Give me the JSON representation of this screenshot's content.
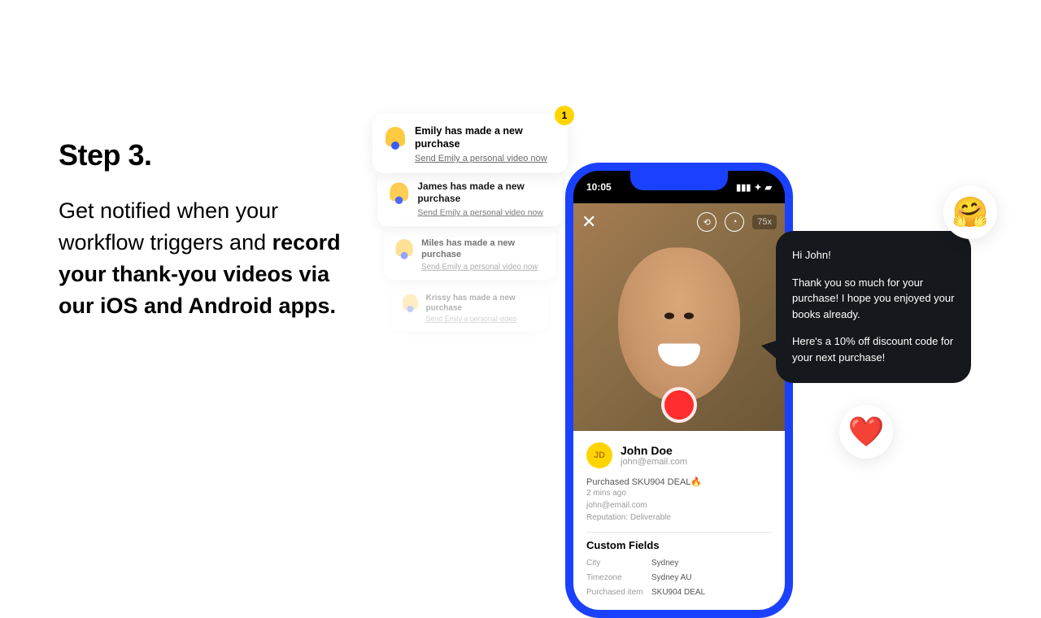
{
  "left": {
    "heading": "Step 3.",
    "body_plain": "Get notified when your workflow triggers and ",
    "body_bold": "record your thank-you videos via our iOS and Android apps."
  },
  "notifications": {
    "badge_count": "1",
    "cards": [
      {
        "title": "Emily has made a new purchase",
        "action": "Send Emily a personal video now"
      },
      {
        "title": "James has made a new purchase",
        "action": "Send Emily a personal video now"
      },
      {
        "title": "Miles has made a new purchase",
        "action": "Send Emily a personal video now"
      },
      {
        "title": "Krissy has made a new purchase",
        "action": "Send Emily a personal video"
      }
    ]
  },
  "phone": {
    "status_time": "10:05",
    "zoom_label": "75x",
    "customer": {
      "initials": "JD",
      "name": "John Doe",
      "email": "john@email.com"
    },
    "purchase_line": "Purchased SKU904 DEAL",
    "fire_emoji": "🔥",
    "meta": {
      "time": "2 mins ago",
      "email": "john@email.com",
      "reputation": "Reputation: Deliverable"
    },
    "custom_fields_heading": "Custom Fields",
    "custom_fields": [
      {
        "key": "City",
        "value": "Sydney"
      },
      {
        "key": "Timezone",
        "value": "Sydney AU"
      },
      {
        "key": "Purchased item",
        "value": "SKU904 DEAL"
      }
    ]
  },
  "speech": {
    "line1": "Hi John!",
    "line2": "Thank you so much for your purchase! I hope you enjoyed your books already.",
    "line3": "Here's a 10% off discount code for your next purchase!"
  },
  "emoji": {
    "hug": "🤗",
    "heart": "❤️"
  }
}
